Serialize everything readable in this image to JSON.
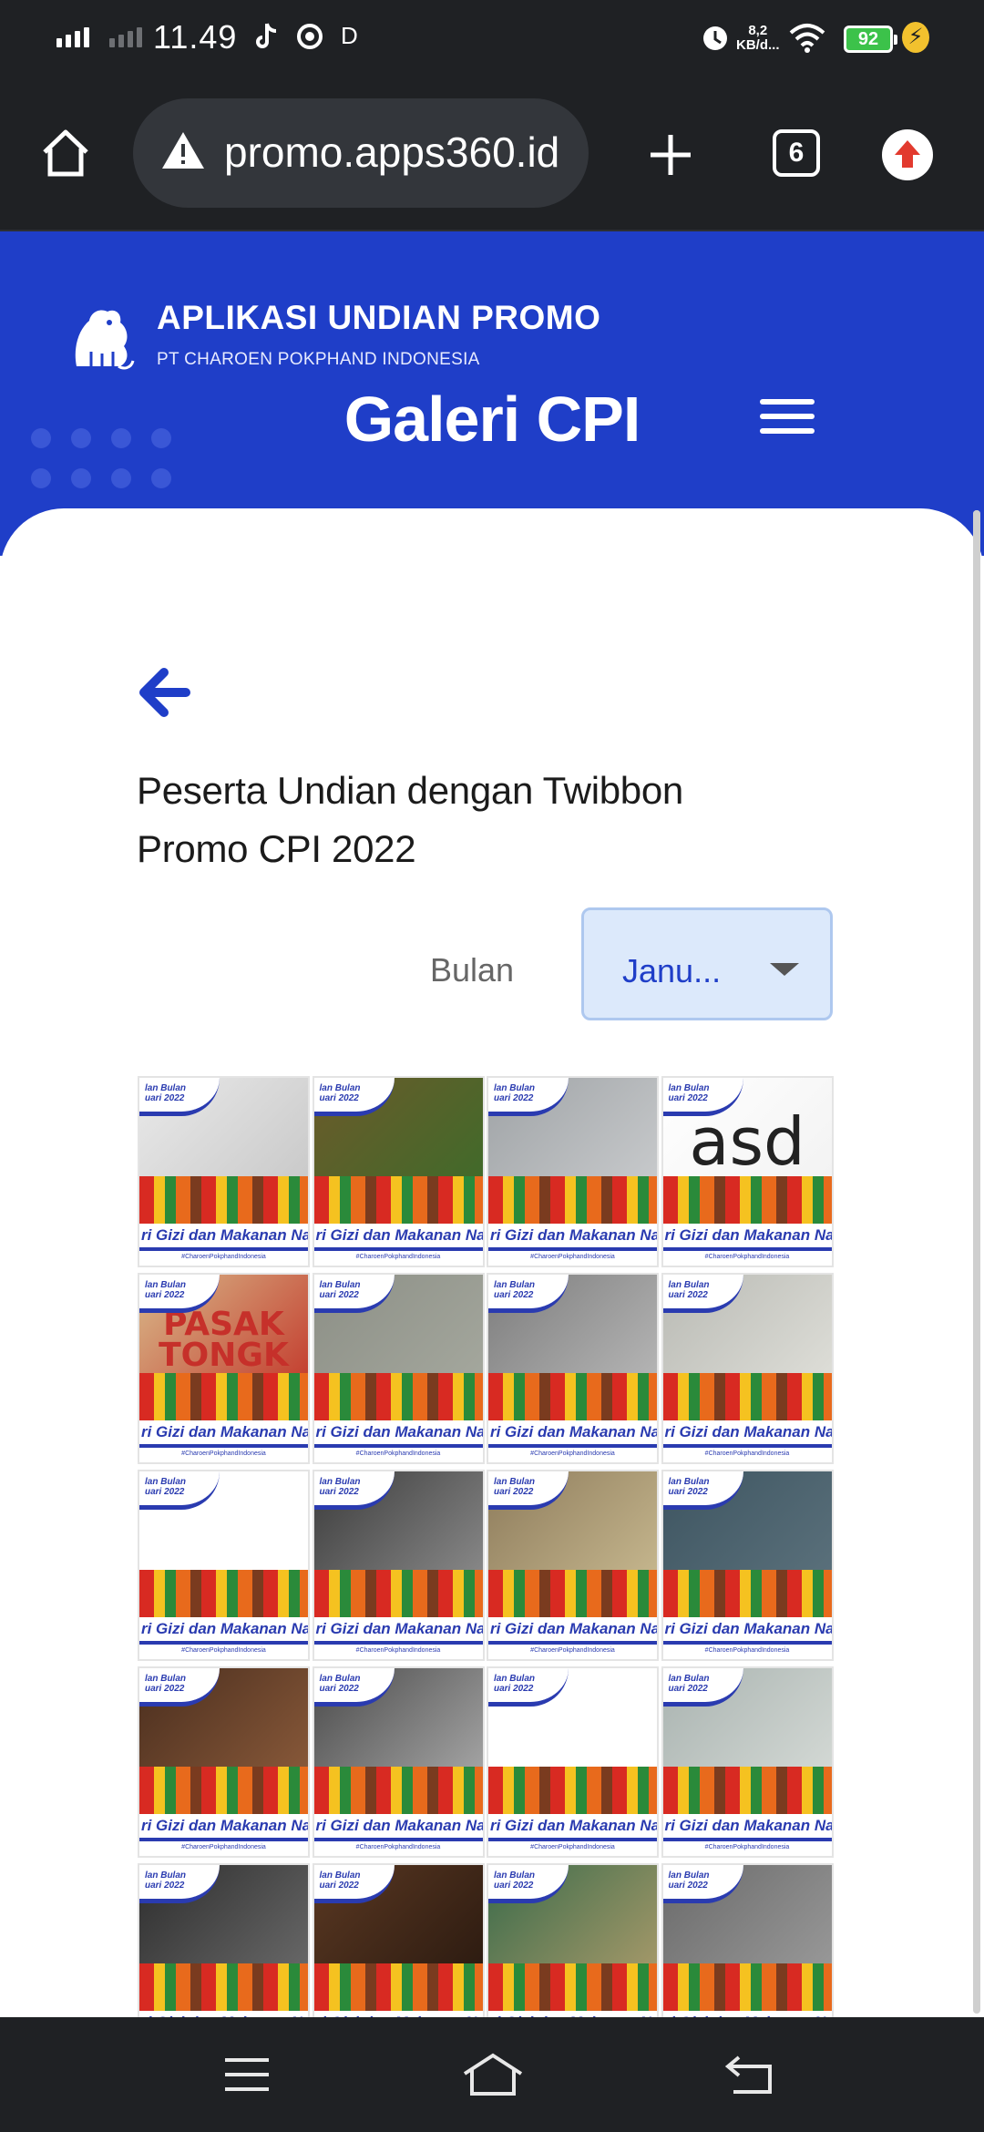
{
  "status_bar": {
    "time": "11.49",
    "notification_letter": "D",
    "network_speed_value": "8,2",
    "network_speed_unit": "KB/d...",
    "battery_level": "92",
    "icons": [
      "signal-icon",
      "signal-dim-icon",
      "tiktok-icon",
      "record-icon",
      "alarm-icon",
      "wifi-icon",
      "battery-icon",
      "charging-icon"
    ]
  },
  "browser": {
    "url": "promo.apps360.id",
    "tab_count": "6"
  },
  "header": {
    "app_name": "APLIKASI UNDIAN PROMO",
    "company": "PT CHAROEN POKPHAND INDONESIA",
    "page_title": "Galeri CPI"
  },
  "content": {
    "section_title": "Peserta Undian dengan Twibbon Promo CPI 2022",
    "filter_label": "Bulan",
    "filter_selected": "Janu..."
  },
  "gallery": {
    "tiles": [
      {
        "photo": "lion-logo",
        "colors": [
          "#e9e9e9",
          "#c8c8c8"
        ],
        "overlay": ""
      },
      {
        "photo": "vegetables",
        "colors": [
          "#6b5a2a",
          "#3f6b2a"
        ],
        "overlay": ""
      },
      {
        "photo": "blue-lion",
        "colors": [
          "#9fa3a6",
          "#c9cbcd"
        ],
        "overlay": ""
      },
      {
        "photo": "asd-text",
        "colors": [
          "#ffffff",
          "#f2f2f2"
        ],
        "overlay": "asd"
      },
      {
        "photo": "bread-pack",
        "colors": [
          "#d8b98a",
          "#c33a2c"
        ],
        "overlay": "PASAK TONGK"
      },
      {
        "photo": "grey-fabric",
        "colors": [
          "#8c8f86",
          "#a5a89e"
        ],
        "overlay": ""
      },
      {
        "photo": "keyboard",
        "colors": [
          "#7d7d7d",
          "#b7b7b7"
        ],
        "overlay": ""
      },
      {
        "photo": "screen-pattern",
        "colors": [
          "#b9bab4",
          "#dfdfd9"
        ],
        "overlay": ""
      },
      {
        "photo": "white",
        "colors": [
          "#ffffff",
          "#ffffff"
        ],
        "overlay": ""
      },
      {
        "photo": "face-portrait",
        "colors": [
          "#3c3c3c",
          "#8b8b8b"
        ],
        "overlay": ""
      },
      {
        "photo": "water-bottle",
        "colors": [
          "#8e7c5c",
          "#c7b88f"
        ],
        "overlay": ""
      },
      {
        "photo": "blue-pattern",
        "colors": [
          "#3e5561",
          "#5b717c"
        ],
        "overlay": ""
      },
      {
        "photo": "clay-pots",
        "colors": [
          "#4a2e1e",
          "#8a5a3a"
        ],
        "overlay": ""
      },
      {
        "photo": "wall-photos",
        "colors": [
          "#4b4b4b",
          "#a7a7a7"
        ],
        "overlay": ""
      },
      {
        "photo": "white",
        "colors": [
          "#ffffff",
          "#ffffff"
        ],
        "overlay": ""
      },
      {
        "photo": "sky",
        "colors": [
          "#a9b3b0",
          "#d5dad6"
        ],
        "overlay": ""
      },
      {
        "photo": "blue-lion-dark",
        "colors": [
          "#2d2d2d",
          "#6a6a6a"
        ],
        "overlay": ""
      },
      {
        "photo": "clay-pots-2",
        "colors": [
          "#5a3822",
          "#2b1a10"
        ],
        "overlay": ""
      },
      {
        "photo": "colorful-food",
        "colors": [
          "#3b6b4a",
          "#a89a6a"
        ],
        "overlay": ""
      },
      {
        "photo": "portrait-man",
        "colors": [
          "#6a6a6a",
          "#9a9a9a"
        ],
        "overlay": ""
      }
    ],
    "tile_badge_line1": "lan Bulan",
    "tile_badge_line2": "uari 2022",
    "tile_slogan": "ri Gizi dan Makanan Nasional",
    "tile_hashtag": "#CharoenPokphandIndonesia"
  }
}
